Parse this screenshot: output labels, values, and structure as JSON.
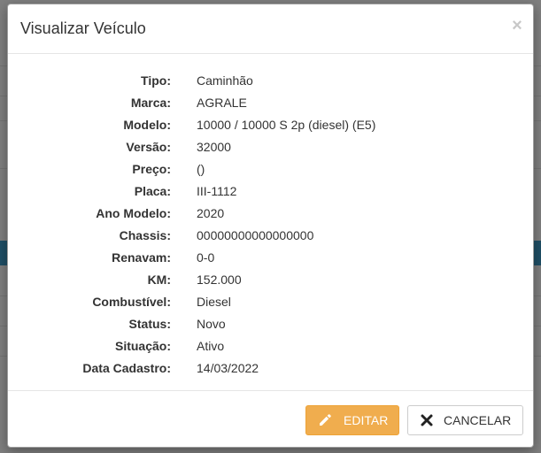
{
  "modal": {
    "title": "Visualizar Veículo",
    "close_glyph": "×"
  },
  "fields": [
    {
      "label": "Tipo:",
      "value": "Caminhão"
    },
    {
      "label": "Marca:",
      "value": "AGRALE"
    },
    {
      "label": "Modelo:",
      "value": "10000 / 10000 S 2p (diesel) (E5)"
    },
    {
      "label": "Versão:",
      "value": "32000"
    },
    {
      "label": "Preço:",
      "value": "()"
    },
    {
      "label": "Placa:",
      "value": "III-1112"
    },
    {
      "label": "Ano Modelo:",
      "value": "2020"
    },
    {
      "label": "Chassis:",
      "value": "00000000000000000"
    },
    {
      "label": "Renavam:",
      "value": "0-0"
    },
    {
      "label": "KM:",
      "value": "152.000"
    },
    {
      "label": "Combustível:",
      "value": "Diesel"
    },
    {
      "label": "Status:",
      "value": "Novo"
    },
    {
      "label": "Situação:",
      "value": "Ativo"
    },
    {
      "label": "Data Cadastro:",
      "value": "14/03/2022"
    }
  ],
  "footer": {
    "edit_label": "EDITAR",
    "cancel_label": "CANCELAR",
    "edit_icon": "pencil-icon",
    "cancel_icon": "times-icon"
  },
  "colors": {
    "edit_button": "#f0ad4e",
    "backdrop_band": "#1f4f66"
  }
}
